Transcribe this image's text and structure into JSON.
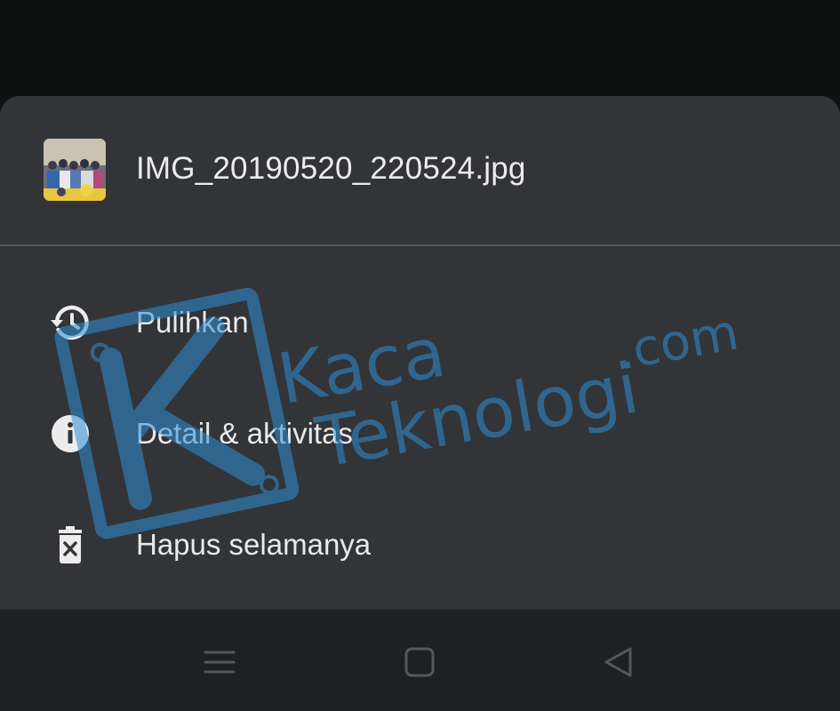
{
  "file": {
    "name": "IMG_20190520_220524.jpg",
    "thumbnail_icon": "photo-thumbnail"
  },
  "menu": {
    "items": [
      {
        "label": "Pulihkan",
        "icon": "restore-history-icon"
      },
      {
        "label": "Detail & aktivitas",
        "icon": "info-icon"
      },
      {
        "label": "Hapus selamanya",
        "icon": "delete-forever-icon"
      }
    ]
  },
  "navigation": {
    "buttons": [
      {
        "icon": "menu-icon"
      },
      {
        "icon": "home-icon"
      },
      {
        "icon": "back-icon"
      }
    ]
  },
  "watermark": {
    "line1": "Kaca",
    "line2": "Teknologi",
    "suffix": ".com"
  },
  "colors": {
    "sheet_background": "#323437",
    "text": "#e9eaeb",
    "navbar": "#1f2022",
    "watermark": "#2f8fd6"
  }
}
